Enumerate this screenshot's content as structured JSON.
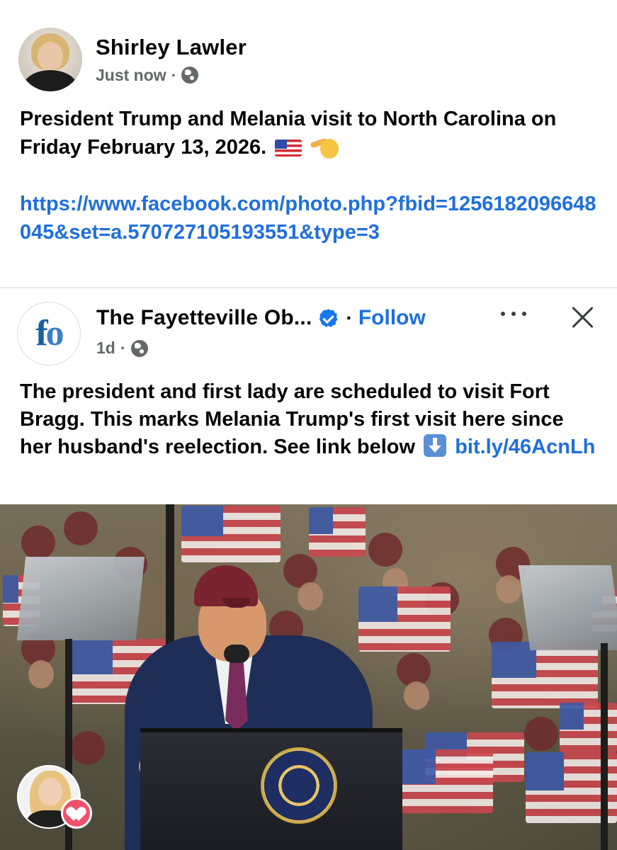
{
  "post": {
    "author": "Shirley Lawler",
    "timestamp": "Just now",
    "separator": "·",
    "privacy_icon": "globe-icon",
    "text": "President Trump and Melania visit to North Carolina on Friday February 13, 2026.",
    "emojis": [
      "flag-us-emoji",
      "saluting-face-emoji"
    ],
    "link": "https://www.facebook.com/photo.php?fbid=1256182096648045&set=a.570727105193551&type=3"
  },
  "shared": {
    "page_name": "The Fayetteville Ob...",
    "logo_text_f": "f",
    "logo_text_o": "o",
    "verified_icon": "verified-badge-icon",
    "follow_separator": "·",
    "follow_label": "Follow",
    "more_icon": "more-options-icon",
    "close_icon": "close-icon",
    "timestamp": "1d",
    "separator": "·",
    "text_before_arrow": "The president and first lady are scheduled to visit Fort Bragg. This marks Melania Trump's first visit here since her husband's reelection. See link below",
    "arrow_icon": "down-arrow-icon",
    "short_link": "bit.ly/46AcnLh"
  },
  "photo": {
    "seal_text_top": "PRESIDENT OF THE UNITED",
    "seal_text_bottom": "SEAL OF THE · STATES ·"
  },
  "reaction": {
    "icon": "love-icon"
  },
  "colors": {
    "link_blue": "#1f6fdc",
    "meta_gray": "#65676b",
    "verified_blue": "#1877f2",
    "love_pink": "#f2506b"
  }
}
